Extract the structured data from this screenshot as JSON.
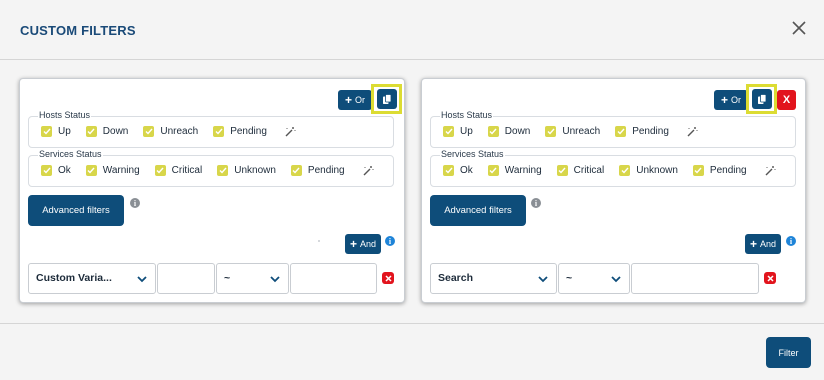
{
  "dialog": {
    "title": "CUSTOM FILTERS",
    "filter_label": "Filter"
  },
  "icons": {
    "close": "close-icon",
    "copy": "copy-icon",
    "wand": "magic-wand-icon",
    "info": "info-icon",
    "chevron": "chevron-down-icon"
  },
  "colors": {
    "primary": "#0e4d7a",
    "checkbox": "#d8d64a",
    "danger": "#e2141d",
    "highlight": "#dcdc33",
    "info": "#1e84d8"
  },
  "groups": [
    {
      "or_label": "Or",
      "hosts_status": {
        "legend": "Hosts Status",
        "options": [
          "Up",
          "Down",
          "Unreach",
          "Pending"
        ]
      },
      "services_status": {
        "legend": "Services Status",
        "options": [
          "Ok",
          "Warning",
          "Critical",
          "Unknown",
          "Pending"
        ]
      },
      "advanced_label": "Advanced filters",
      "and_label": "And",
      "condition": {
        "field": "Custom Varia...",
        "operator": "~",
        "value": ""
      }
    },
    {
      "or_label": "Or",
      "delete_label": "X",
      "hosts_status": {
        "legend": "Hosts Status",
        "options": [
          "Up",
          "Down",
          "Unreach",
          "Pending"
        ]
      },
      "services_status": {
        "legend": "Services Status",
        "options": [
          "Ok",
          "Warning",
          "Critical",
          "Unknown",
          "Pending"
        ]
      },
      "advanced_label": "Advanced filters",
      "and_label": "And",
      "condition": {
        "field": "Search",
        "operator": "~",
        "value": ""
      }
    }
  ]
}
